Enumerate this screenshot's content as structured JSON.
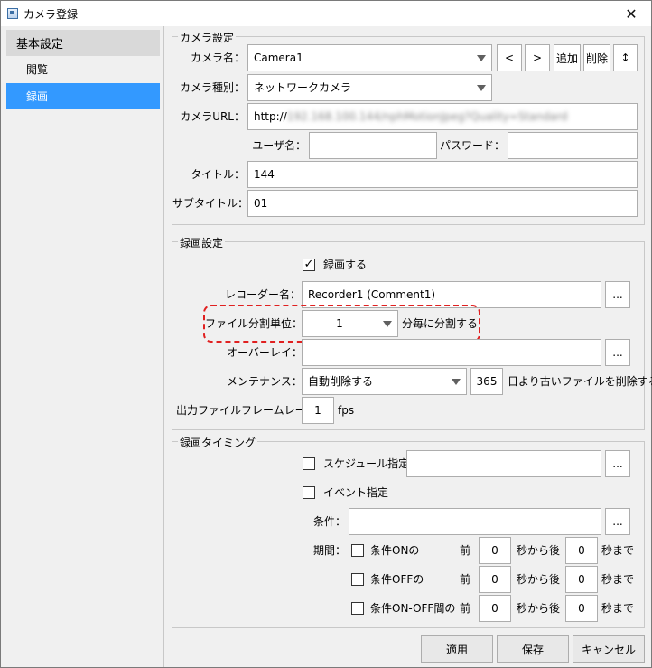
{
  "window": {
    "title": "カメラ登録",
    "close": "✕"
  },
  "nav": [
    {
      "label": "基本設定"
    },
    {
      "label": "閲覧"
    },
    {
      "label": "録画"
    }
  ],
  "camera": {
    "group_title": "カメラ設定",
    "name_label": "カメラ名：",
    "name_value": "Camera1",
    "btn_prev": "<",
    "btn_next": ">",
    "btn_add": "追加",
    "btn_delete": "削除",
    "btn_sort": "↕",
    "type_label": "カメラ種別：",
    "type_value": "ネットワークカメラ",
    "url_label": "カメラURL：",
    "url_prefix": "http://",
    "url_rest": "192.168.100.144/nphMotionJpeg?Quality=Standard",
    "user_label": "ユーザ名：",
    "user_value": "",
    "password_label": "パスワード：",
    "password_value": "",
    "title_label": "タイトル：",
    "title_value": "144",
    "subtitle_label": "サブタイトル：",
    "subtitle_value": "01"
  },
  "recording": {
    "group_title": "録画設定",
    "record_checkbox_label": "録画する",
    "record_checked": true,
    "recorder_label": "レコーダー名：",
    "recorder_value": "Recorder1 (Comment1)",
    "split_label": "ファイル分割単位：",
    "split_value": "1",
    "split_suffix": "分毎に分割する",
    "overlay_label": "オーバーレイ：",
    "overlay_value": "",
    "maintenance_label": "メンテナンス：",
    "maintenance_value": "自動削除する",
    "maintenance_days": "365",
    "maintenance_suffix": "日より古いファイルを削除する",
    "framerate_label": "出力ファイルフレームレート：",
    "framerate_value": "1",
    "framerate_unit": "fps",
    "browse": "..."
  },
  "timing": {
    "group_title": "録画タイミング",
    "schedule_label": "スケジュール指定：",
    "schedule_value": "",
    "event_label": "イベント指定",
    "condition_label": "条件：",
    "condition_value": "",
    "period_label": "期間：",
    "rows": [
      {
        "label": "条件ONの",
        "before_label": "前",
        "before": "0",
        "mid": "秒から後",
        "after": "0",
        "end": "秒まで"
      },
      {
        "label": "条件OFFの",
        "before_label": "前",
        "before": "0",
        "mid": "秒から後",
        "after": "0",
        "end": "秒まで"
      },
      {
        "label": "条件ON-OFF間の",
        "before_label": "前",
        "before": "0",
        "mid": "秒から後",
        "after": "0",
        "end": "秒まで"
      }
    ]
  },
  "footer": {
    "apply": "適用",
    "save": "保存",
    "cancel": "キャンセル"
  },
  "colors": {
    "selection": "#3399ff",
    "highlight": "#e02020"
  }
}
